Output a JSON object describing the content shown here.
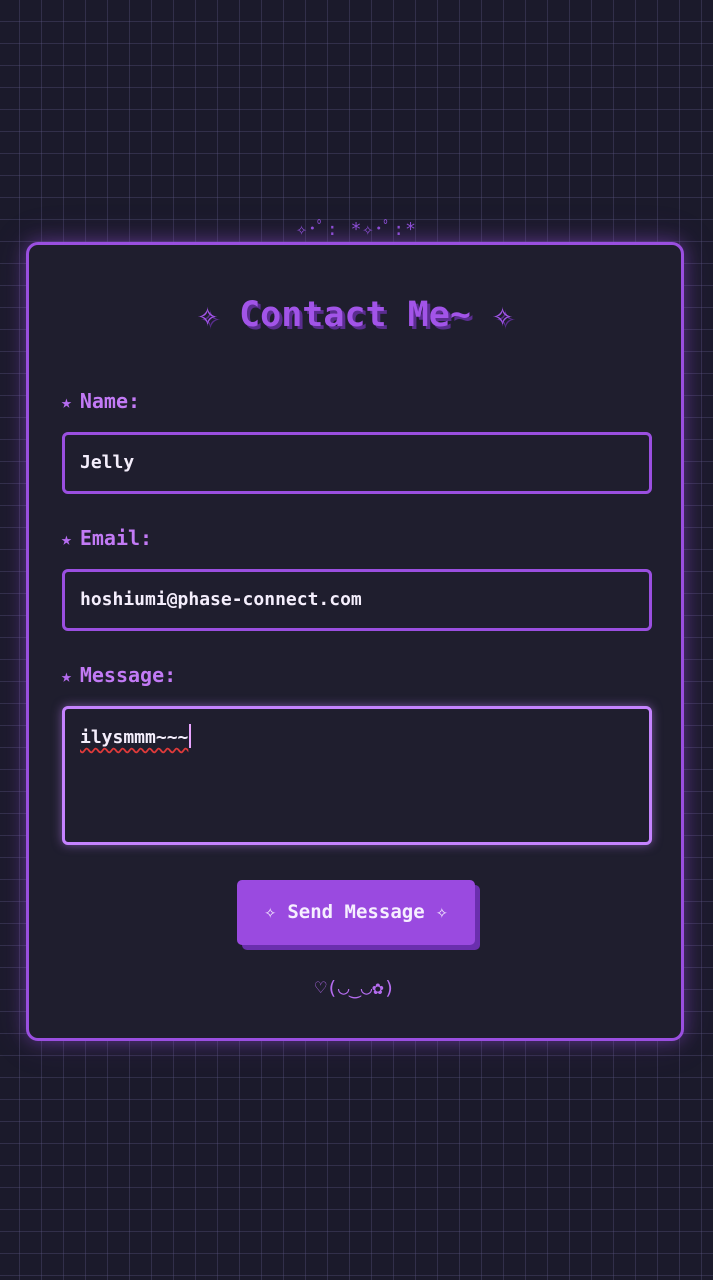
{
  "decoration": {
    "top_sparkles": "✧･ﾟ: *✧･ﾟ:*"
  },
  "form": {
    "title": "✧ Contact Me~ ✧",
    "fields": {
      "name": {
        "star": "★",
        "label": "Name:",
        "value": "Jelly"
      },
      "email": {
        "star": "★",
        "label": "Email:",
        "value": "hoshiumi@phase-connect.com"
      },
      "message": {
        "star": "★",
        "label": "Message:",
        "value": "ilysmmm~~~"
      }
    },
    "submit_label": "✧ Send Message ✧",
    "kaomoji": "♡(◡‿◡✿)"
  },
  "colors": {
    "background": "#1b1a2b",
    "card": "#1f1e2e",
    "accent": "#9a4fe0",
    "accent_light": "#c27af5",
    "text": "#f4eefc",
    "spellcheck_underline": "#e03a3a"
  }
}
